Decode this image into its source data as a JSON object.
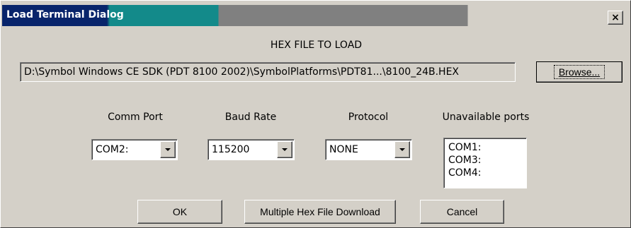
{
  "window": {
    "title": "Load Terminal Dialog",
    "close_label": "×"
  },
  "heading": "HEX FILE TO LOAD",
  "file_path": "D:\\Symbol Windows CE SDK (PDT 8100 2002)\\SymbolPlatforms\\PDT81...\\8100_24B.HEX",
  "browse_label": "Browse...",
  "comm_port": {
    "label": "Comm Port",
    "value": "COM2:"
  },
  "baud_rate": {
    "label": "Baud Rate",
    "value": "115200"
  },
  "protocol": {
    "label": "Protocol",
    "value": "NONE"
  },
  "unavailable_ports": {
    "label": "Unavailable ports",
    "items": [
      "COM1:",
      "COM3:",
      "COM4:"
    ]
  },
  "buttons": {
    "ok": "OK",
    "multiple": "Multiple Hex File Download",
    "cancel": "Cancel"
  },
  "colors": {
    "title_active": "#08246b",
    "progress_fill": "#138a8a",
    "progress_track": "#808080",
    "dialog_face": "#d4d0c8"
  }
}
